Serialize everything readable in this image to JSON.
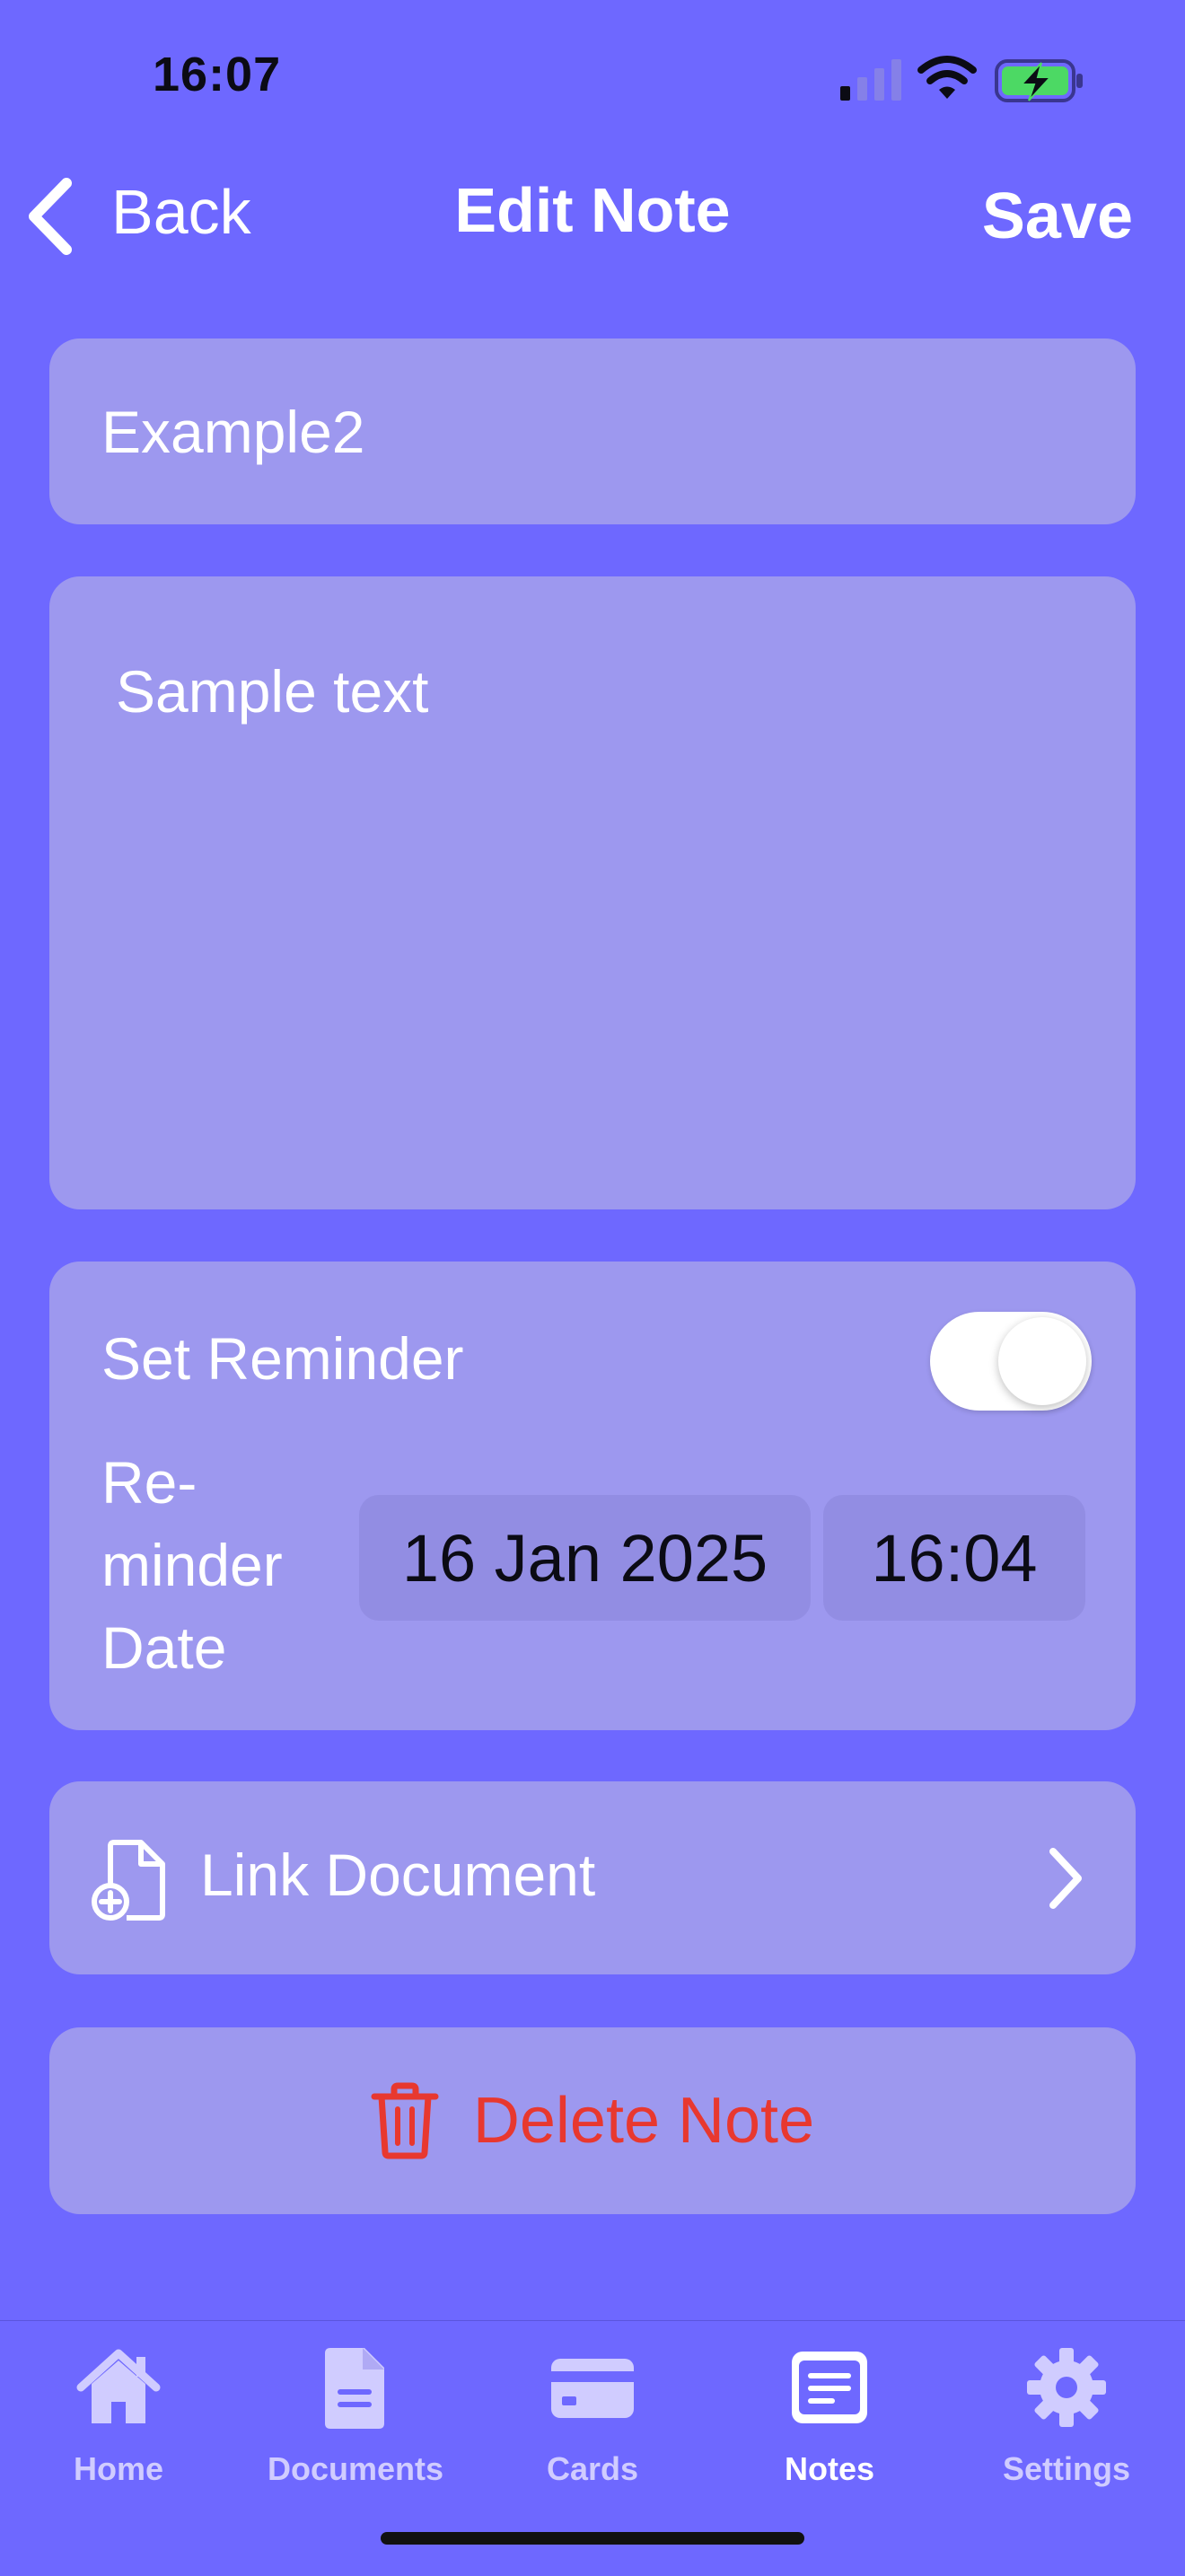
{
  "status_bar": {
    "time": "16:07"
  },
  "nav": {
    "back_label": "Back",
    "title": "Edit Note",
    "save_label": "Save"
  },
  "note": {
    "title_value": "Example2",
    "body_value": "Sample text"
  },
  "reminder": {
    "set_label": "Set Reminder",
    "enabled": true,
    "date_label": "Re-\nminder\nDate",
    "date_value": "16 Jan 2025",
    "time_value": "16:04"
  },
  "link_document": {
    "label": "Link Document"
  },
  "delete": {
    "label": "Delete Note",
    "color": "#E8382F"
  },
  "tabs": [
    {
      "label": "Home",
      "icon": "home-icon",
      "active": false
    },
    {
      "label": "Documents",
      "icon": "document-icon",
      "active": false
    },
    {
      "label": "Cards",
      "icon": "card-icon",
      "active": false
    },
    {
      "label": "Notes",
      "icon": "notes-icon",
      "active": true
    },
    {
      "label": "Settings",
      "icon": "gear-icon",
      "active": false
    }
  ],
  "colors": {
    "background": "#6E68FF",
    "card": "#9D98EF",
    "pill": "#928DE3",
    "battery": "#4CD964"
  }
}
